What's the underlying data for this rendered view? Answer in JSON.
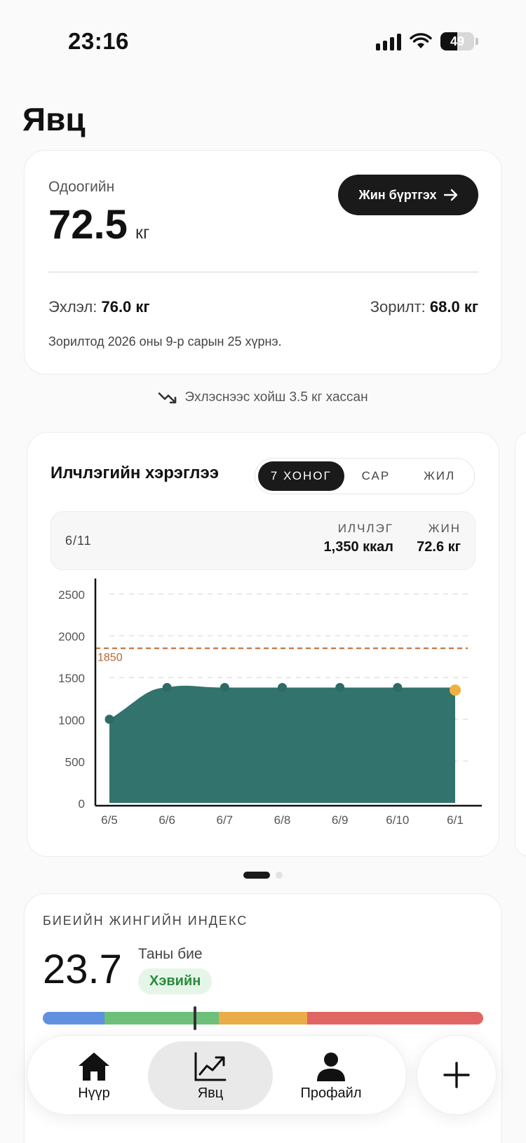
{
  "status_bar": {
    "time": "23:16",
    "battery": "49",
    "battery_level": 0.49
  },
  "page": {
    "title": "Явц"
  },
  "weight_card": {
    "current_label": "Одоогийн",
    "current_value": "72.5",
    "unit": "кг",
    "log_button": "Жин бүртгэх",
    "start_label": "Эхлэл:",
    "start_value": "76.0 кг",
    "goal_label": "Зорилт:",
    "goal_value": "68.0 кг",
    "eta_text": "Зорилтод 2026 оны 9-р сарын 25 хүрнэ."
  },
  "progress_note": {
    "text": "Эхлэснээс хойш 3.5 кг хассан",
    "icon": "trending-down-icon"
  },
  "calorie_card": {
    "title": "Илчлэгийн хэрэглээ",
    "tabs": [
      "7 ХОНОГ",
      "САР",
      "ЖИЛ"
    ],
    "active_tab": 0,
    "selected_day": {
      "date": "6/11",
      "calorie_header": "ИЛЧЛЭГ",
      "calorie_value": "1,350 ккал",
      "weight_header": "ЖИН",
      "weight_value": "72.6 кг"
    }
  },
  "chart_data": {
    "type": "area",
    "x": [
      "6/5",
      "6/6",
      "6/7",
      "6/8",
      "6/9",
      "6/10",
      "6/1"
    ],
    "values": [
      1000,
      1380,
      1380,
      1380,
      1380,
      1380,
      1350
    ],
    "y_ticks": [
      "0",
      "500",
      "1000",
      "1500",
      "2000",
      "2500"
    ],
    "ylim": [
      0,
      2500
    ],
    "target": 1850,
    "target_label": "1850",
    "grid": true,
    "colors": {
      "area": "#33736d",
      "target": "#b8642e",
      "highlight": "#f0b040"
    }
  },
  "carousel": {
    "pages": 2,
    "active": 0
  },
  "bmi_card": {
    "label": "БИЕИЙН ЖИНГИЙН ИНДЕКС",
    "value": "23.7",
    "subtitle": "Таны бие",
    "category": "Хэвийн",
    "segments": [
      {
        "color": "#6190e0",
        "share": 0.14
      },
      {
        "color": "#6cc07a",
        "share": 0.26
      },
      {
        "color": "#e9ac48",
        "share": 0.2
      },
      {
        "color": "#e06664",
        "share": 0.4
      }
    ],
    "marker_fraction": 0.345
  },
  "bottom_nav": {
    "items": [
      {
        "label": "Нүүр",
        "icon": "home-icon"
      },
      {
        "label": "Явц",
        "icon": "chart-icon"
      },
      {
        "label": "Профайл",
        "icon": "person-icon"
      }
    ],
    "active": 1,
    "fab_icon": "plus-icon"
  }
}
